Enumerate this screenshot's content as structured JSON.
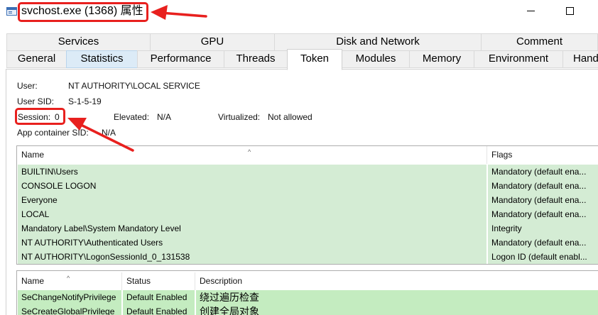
{
  "window": {
    "title": "svchost.exe (1368) 属性",
    "icon": "window-app-icon",
    "highlight_color": "#e8201e"
  },
  "tabs": {
    "row1": [
      "Services",
      "GPU",
      "Disk and Network",
      "Comment"
    ],
    "row2": [
      "General",
      "Statistics",
      "Performance",
      "Threads",
      "Token",
      "Modules",
      "Memory",
      "Environment",
      "Handles"
    ],
    "active": "Token"
  },
  "token": {
    "user_label": "User:",
    "user_value": "NT AUTHORITY\\LOCAL SERVICE",
    "sid_label": "User SID:",
    "sid_value": "S-1-5-19",
    "session_label": "Session:",
    "session_value": "0",
    "elevated_label": "Elevated:",
    "elevated_value": "N/A",
    "virtualized_label": "Virtualized:",
    "virtualized_value": "Not allowed",
    "app_container_label": "App container SID:",
    "app_container_value": "N/A"
  },
  "groups": {
    "columns": [
      "Name",
      "Flags"
    ],
    "rows": [
      {
        "name": "BUILTIN\\Users",
        "flags": "Mandatory (default ena..."
      },
      {
        "name": "CONSOLE LOGON",
        "flags": "Mandatory (default ena..."
      },
      {
        "name": "Everyone",
        "flags": "Mandatory (default ena..."
      },
      {
        "name": "LOCAL",
        "flags": "Mandatory (default ena..."
      },
      {
        "name": "Mandatory Label\\System Mandatory Level",
        "flags": "Integrity"
      },
      {
        "name": "NT AUTHORITY\\Authenticated Users",
        "flags": "Mandatory (default ena..."
      },
      {
        "name": "NT AUTHORITY\\LogonSessionId_0_131538",
        "flags": "Logon ID (default enabl..."
      }
    ]
  },
  "privileges": {
    "columns": [
      "Name",
      "Status",
      "Description"
    ],
    "rows": [
      {
        "name": "SeChangeNotifyPrivilege",
        "status": "Default Enabled",
        "description": "绕过遍历检查"
      },
      {
        "name": "SeCreateGlobalPrivilege",
        "status": "Default Enabled",
        "description": "创建全局对象"
      }
    ]
  }
}
